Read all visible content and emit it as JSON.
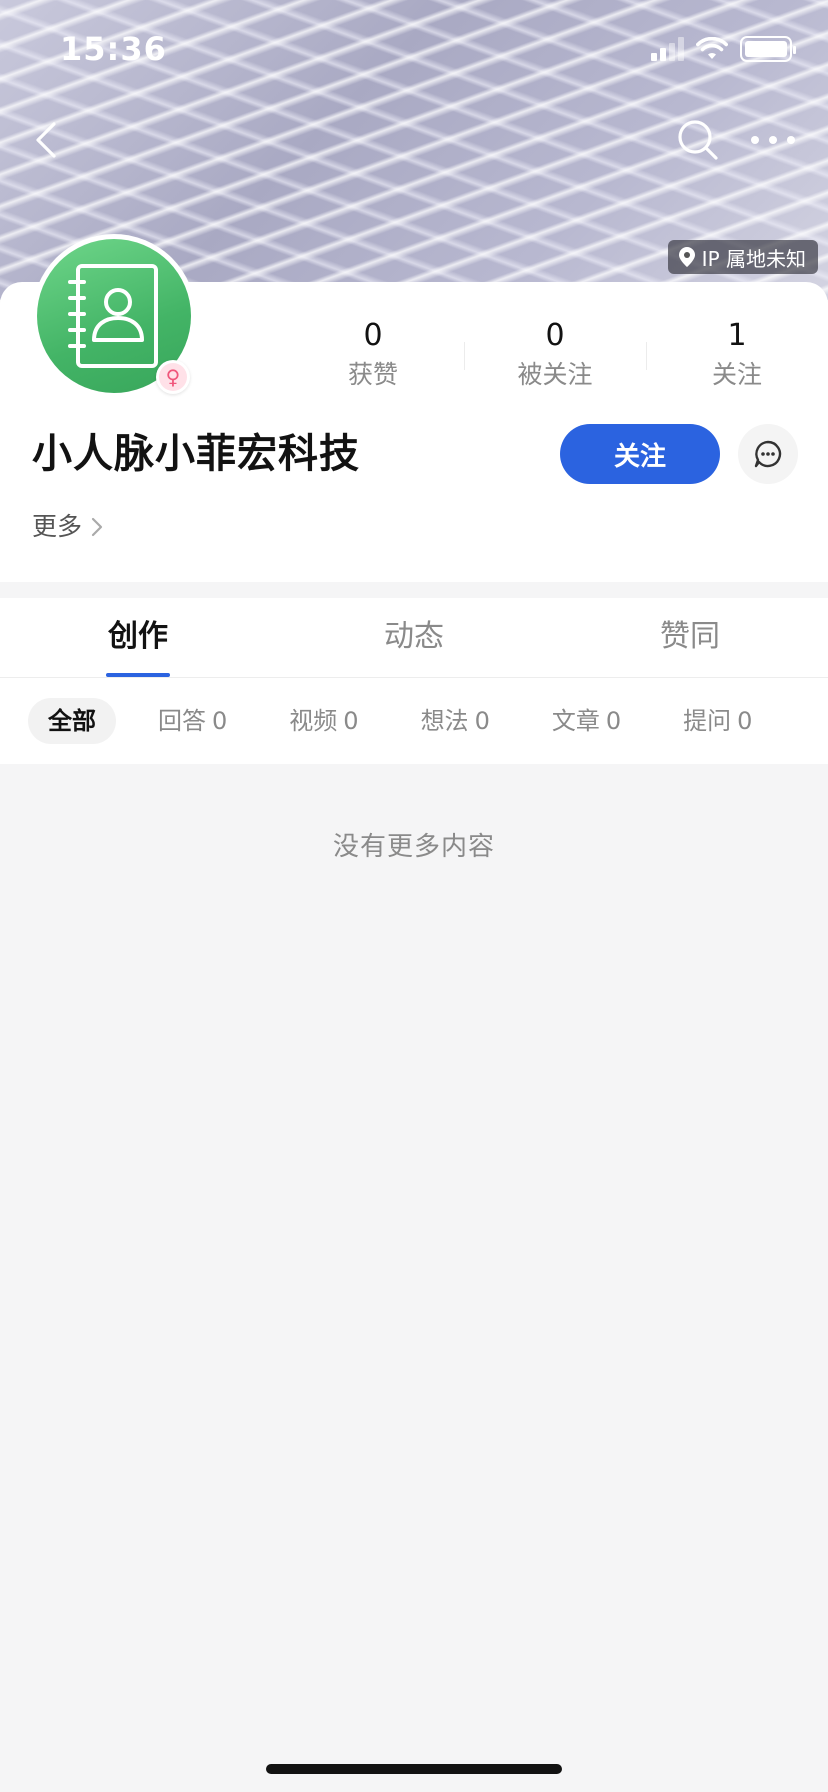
{
  "status_bar": {
    "time": "15:36"
  },
  "header": {
    "ip_location": "IP 属地未知"
  },
  "profile": {
    "name": "小人脉小菲宏科技",
    "gender_symbol": "♀",
    "stats": [
      {
        "value": "0",
        "label": "获赞"
      },
      {
        "value": "0",
        "label": "被关注"
      },
      {
        "value": "1",
        "label": "关注"
      }
    ],
    "follow_label": "关注",
    "more_label": "更多"
  },
  "tabs": [
    {
      "label": "创作",
      "active": true
    },
    {
      "label": "动态",
      "active": false
    },
    {
      "label": "赞同",
      "active": false
    }
  ],
  "filters": [
    {
      "label": "全部",
      "count": ""
    },
    {
      "label": "回答",
      "count": "0"
    },
    {
      "label": "视频",
      "count": "0"
    },
    {
      "label": "想法",
      "count": "0"
    },
    {
      "label": "文章",
      "count": "0"
    },
    {
      "label": "提问",
      "count": "0"
    }
  ],
  "empty_text": "没有更多内容",
  "colors": {
    "accent": "#2b63e0",
    "avatar_green": "#43b466",
    "female_pink": "#f0567b"
  }
}
